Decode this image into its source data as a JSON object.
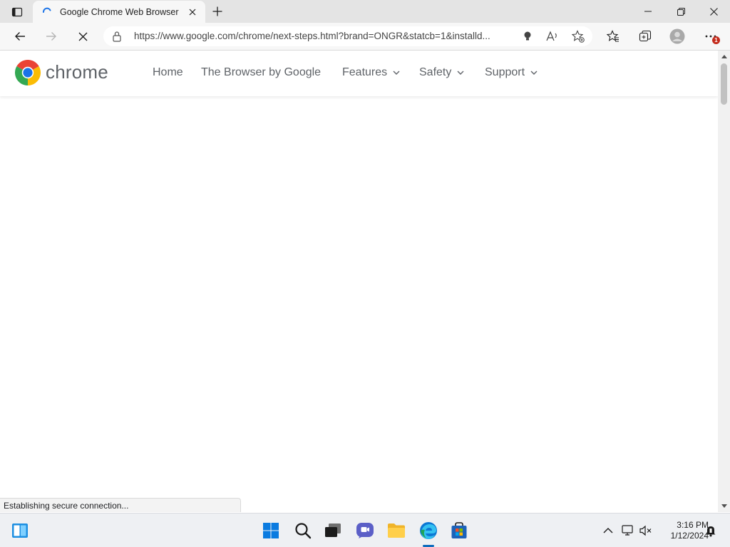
{
  "browser": {
    "tab": {
      "title": "Google Chrome Web Browser",
      "loading": true
    },
    "address_bar": {
      "url": "https://www.google.com/chrome/next-steps.html?brand=ONGR&statcb=1&installd..."
    },
    "profile_badge": "1",
    "status_text": "Establishing secure connection..."
  },
  "site": {
    "logo_text": "chrome",
    "nav": [
      {
        "label": "Home",
        "has_dropdown": false
      },
      {
        "label": "The Browser by Google",
        "has_dropdown": false
      },
      {
        "label": "Features",
        "has_dropdown": true
      },
      {
        "label": "Safety",
        "has_dropdown": true
      },
      {
        "label": "Support",
        "has_dropdown": true
      }
    ]
  },
  "taskbar": {
    "items": [
      "start-icon",
      "search-icon",
      "task-view-icon",
      "chat-icon",
      "file-explorer-icon",
      "edge-icon",
      "store-icon"
    ],
    "active_item": "edge-icon"
  },
  "tray": {
    "time": "3:16 PM",
    "date": "1/12/2024"
  },
  "colors": {
    "accent": "#0f6cbd",
    "chrome_red": "#ea4335",
    "chrome_yellow": "#fbbc04",
    "chrome_green": "#34a853",
    "chrome_blue": "#1a73e8"
  }
}
